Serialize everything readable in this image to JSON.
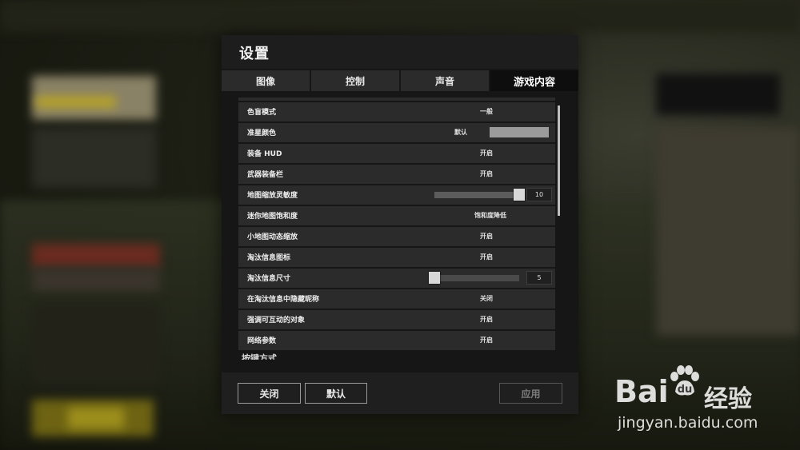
{
  "dialog": {
    "title": "设置",
    "tabs": [
      {
        "label": "图像",
        "active": false
      },
      {
        "label": "控制",
        "active": false
      },
      {
        "label": "声音",
        "active": false
      },
      {
        "label": "游戏内容",
        "active": true
      }
    ]
  },
  "settings": {
    "colorblind": {
      "label": "色盲模式",
      "value": "一般"
    },
    "crosshair": {
      "label": "准星颜色",
      "value": "默认",
      "swatch_color": "#9b9b9b"
    },
    "equip_hud": {
      "label": "装备 HUD",
      "value": "开启"
    },
    "weapon_bar": {
      "label": "武器装备栏",
      "value": "开启"
    },
    "map_zoom": {
      "label": "地图缩放灵敏度",
      "value": "10",
      "level": 1.0
    },
    "minimap_sat": {
      "label": "迷你地图饱和度",
      "value": "饱和度降低"
    },
    "minimap_dyn": {
      "label": "小地图动态缩放",
      "value": "开启"
    },
    "kill_icon": {
      "label": "淘汰信息图标",
      "value": "开启"
    },
    "kill_size": {
      "label": "淘汰信息尺寸",
      "value": "5",
      "level": 0.0
    },
    "hide_nick": {
      "label": "在淘汰信息中隐藏昵称",
      "value": "关闭"
    },
    "interact": {
      "label": "强调可互动的对象",
      "value": "开启"
    },
    "network": {
      "label": "网络参数",
      "value": "开启"
    }
  },
  "section_next": "按键方式",
  "footer": {
    "close": "关闭",
    "default": "默认",
    "apply": "应用"
  },
  "watermark": {
    "logo_text": "Bai",
    "logo_cn": "经验",
    "url": "jingyan.baidu.com"
  }
}
